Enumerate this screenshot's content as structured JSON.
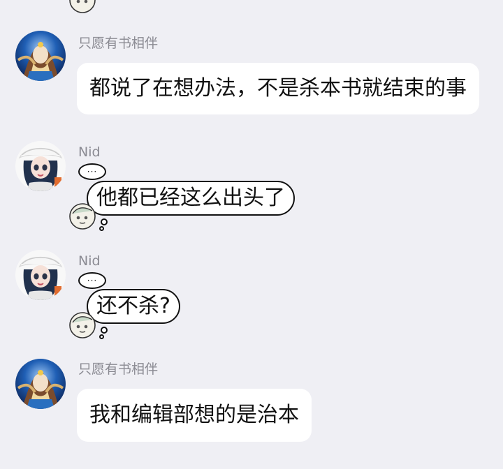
{
  "messages": [
    {
      "sender": "只愿有书相伴",
      "text": "都说了在想办法，不是杀本书就结束的事",
      "style": "bubble"
    },
    {
      "sender": "Nid",
      "thought_mark": "···",
      "text": "他都已经这么出头了",
      "style": "thought"
    },
    {
      "sender": "Nid",
      "thought_mark": "···",
      "text": "还不杀?",
      "style": "thought"
    },
    {
      "sender": "只愿有书相伴",
      "text": "我和编辑部想的是治本",
      "style": "bubble"
    }
  ],
  "colors": {
    "background": "#efeff4",
    "bubble": "#ffffff",
    "name": "#8a8a92",
    "text": "#111111"
  },
  "icons": {
    "avatar_1": "anime-girl-avatar-icon",
    "avatar_2": "anime-girl-white-hat-avatar-icon",
    "sticker": "small-chibi-sticker-icon"
  }
}
